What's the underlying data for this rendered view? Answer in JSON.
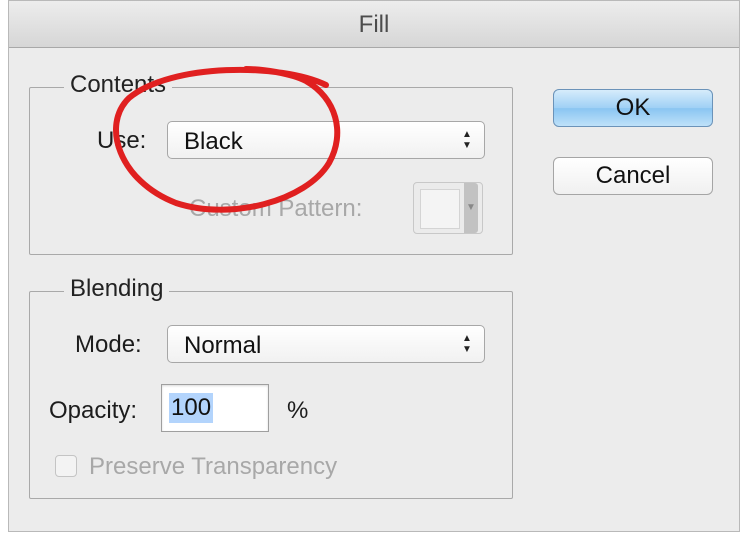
{
  "window": {
    "title": "Fill"
  },
  "contents": {
    "legend": "Contents",
    "use_label": "Use:",
    "use_value": "Black",
    "custom_pattern_label": "Custom Pattern:"
  },
  "blending": {
    "legend": "Blending",
    "mode_label": "Mode:",
    "mode_value": "Normal",
    "opacity_label": "Opacity:",
    "opacity_value": "100",
    "opacity_unit": "%",
    "preserve_label": "Preserve Transparency",
    "preserve_checked": false
  },
  "buttons": {
    "ok": "OK",
    "cancel": "Cancel"
  },
  "colors": {
    "annotation": "#e02020",
    "default_button": "#9fd0f5"
  }
}
